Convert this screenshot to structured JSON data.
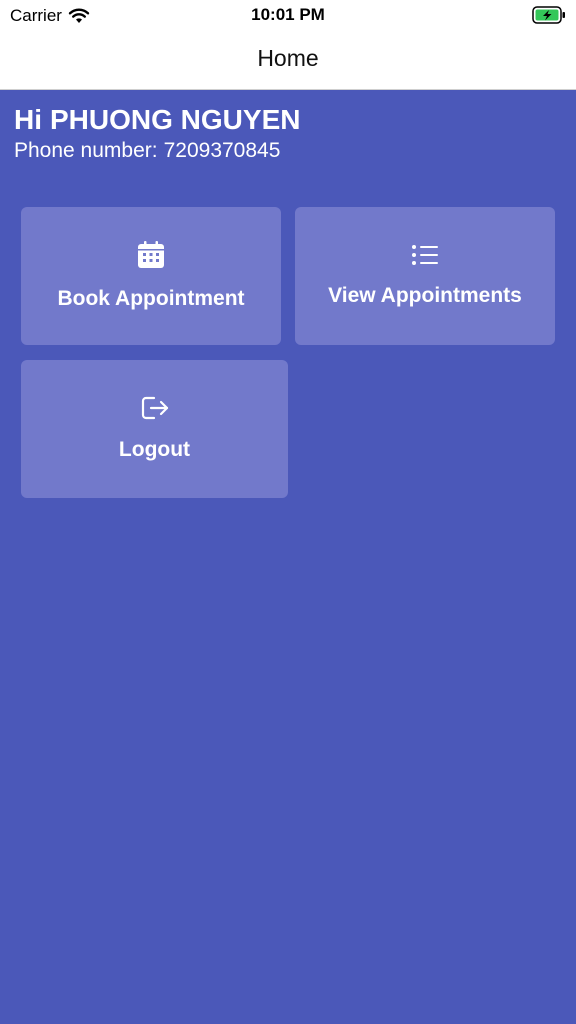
{
  "status_bar": {
    "carrier": "Carrier",
    "time": "10:01 PM",
    "wifi_icon": "wifi-icon",
    "battery_icon": "battery-charging-icon",
    "battery_color": "#34c759"
  },
  "nav": {
    "title": "Home"
  },
  "user": {
    "greeting_prefix": "Hi",
    "name": "PHUONG NGUYEN",
    "phone_label": "Phone number:",
    "phone": "7209370845"
  },
  "tiles": [
    {
      "label": "Book Appointment",
      "icon": "calendar-icon"
    },
    {
      "label": "View Appointments",
      "icon": "list-icon"
    },
    {
      "label": "Logout",
      "icon": "logout-icon"
    }
  ],
  "colors": {
    "background": "#4b58b9",
    "tile": "#7279cb",
    "text": "#ffffff"
  }
}
